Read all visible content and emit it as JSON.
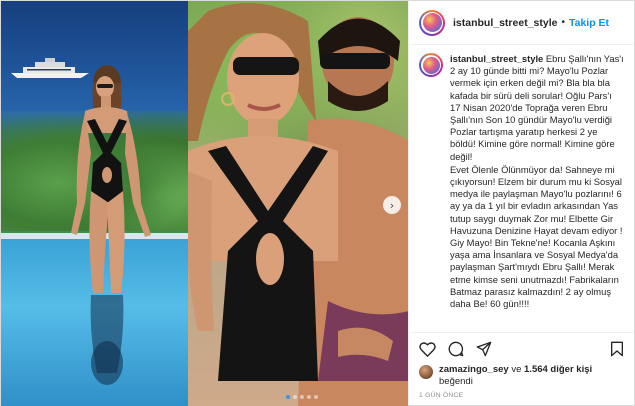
{
  "post": {
    "username": "istanbul_street_style",
    "follow_label": "Takip Et",
    "separator": "•"
  },
  "caption": {
    "username": "istanbul_street_style",
    "paragraphs": [
      "Ebru Şallı'nın Yas'ı 2 ay 10 günde bitti mi? Mayo'lu Pozlar vermek için erken değil mi? Bla bla bla kafada bir sürü deli sorular! Oğlu Pars'ı 17 Nisan 2020'de Toprağa veren Ebru Şallı'nın Son 10 gündür Mayo'lu verdiği Pozlar tartışma yaratıp herkesi 2 ye böldü! Kimine göre normal! Kimine göre değil!",
      "Evet Ölenle Ölünmüyor da! Sahneye mi çıkıyorsun! Elzem bir durum mu ki Sosyal medya ile paylaşman Mayo'lu pozlarını! 6 ay ya da 1 yıl bir evladın arkasından Yas tutup saygı duymak Zor mu! Elbette Gir Havuzuna Denizine Hayat devam ediyor ! Giy Mayo! Bin Tekne'ne! Kocanla Aşkını yaşa ama İnsanlara ve Sosyal Medya'da paylaşman Şart'mıydı Ebru Şallı! Merak etme kimse seni unutmazdı! Fabrikaların Batmaz parasız kalmazdın! 2 ay olmuş daha Be! 60 gün!!!!"
    ]
  },
  "actions": {
    "like_icon": "heart-icon",
    "comment_icon": "comment-icon",
    "share_icon": "share-icon",
    "save_icon": "bookmark-icon"
  },
  "likes": {
    "liker": "zamazingo_sey",
    "connector": " ve ",
    "others": "1.564 diğer kişi",
    "suffix": " beğendi"
  },
  "timestamp": "1 GÜN ÖNCE",
  "carousel": {
    "next_icon": "chevron-right-icon",
    "dot_count": 5,
    "active_dot": 0,
    "active_color": "#3897f0"
  },
  "colors": {
    "follow_blue": "#0095f6",
    "text": "#262626",
    "muted": "#8e8e8e"
  }
}
